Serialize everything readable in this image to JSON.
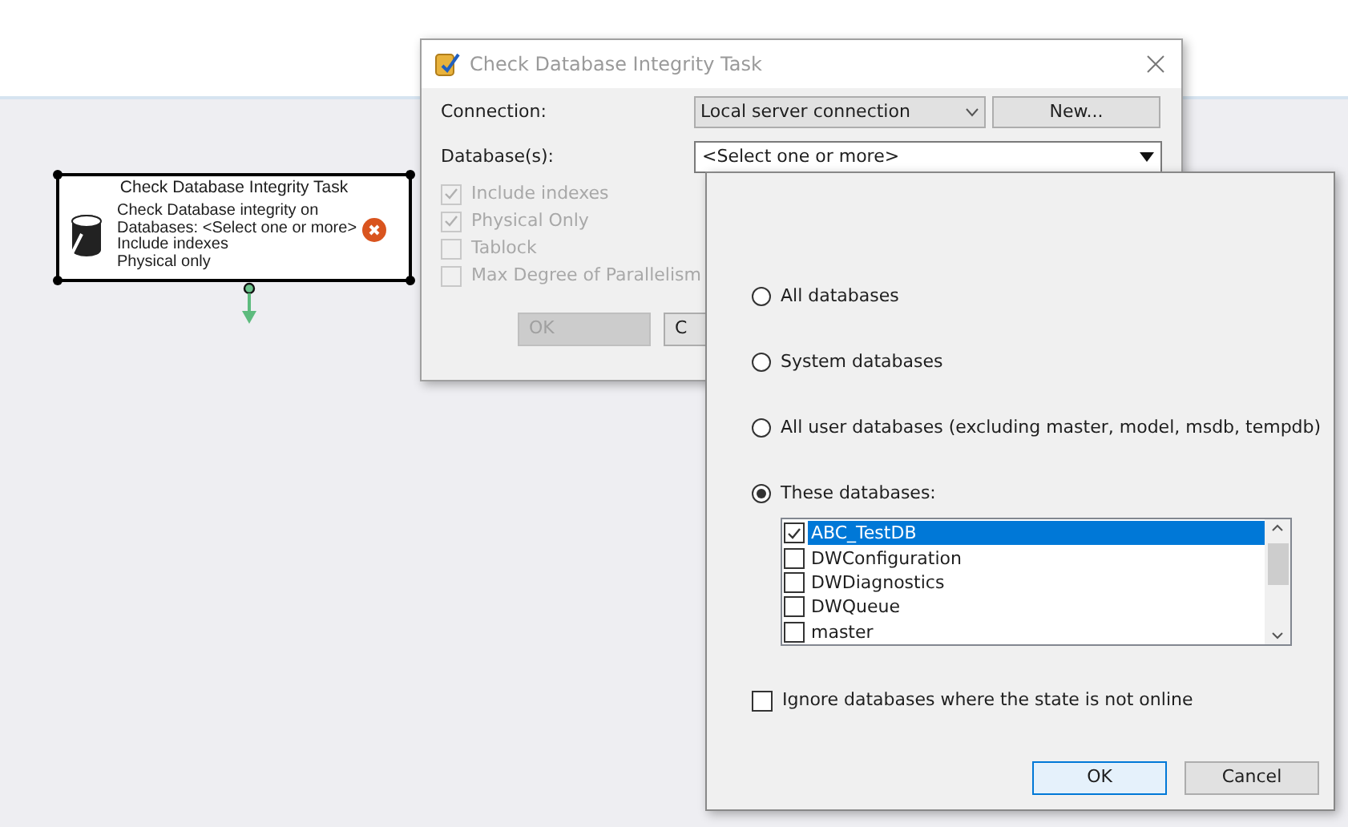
{
  "task": {
    "title": "Check Database Integrity Task",
    "lines": [
      "Check Database integrity on",
      "Databases: <Select one or more>",
      "Include indexes",
      "Physical only"
    ],
    "has_error": true
  },
  "dialog": {
    "title": "Check Database Integrity Task",
    "connection": {
      "label": "Connection:",
      "value": "Local server connection",
      "button": "New..."
    },
    "databases": {
      "label": "Database(s):",
      "value": "<Select one or more>"
    },
    "options": [
      {
        "label": "Include indexes",
        "checked": true,
        "disabled": true
      },
      {
        "label": "Physical Only",
        "checked": true,
        "disabled": true
      },
      {
        "label": "Tablock",
        "checked": false,
        "disabled": true
      },
      {
        "label": "Max Degree of Parallelism",
        "checked": false,
        "disabled": true
      }
    ],
    "buttons": [
      {
        "label": "OK",
        "disabled": true
      },
      {
        "label": "C",
        "disabled": false
      }
    ]
  },
  "popup": {
    "choices": [
      {
        "label": "All databases",
        "selected": false
      },
      {
        "label": "System databases",
        "selected": false
      },
      {
        "label": "All user databases  (excluding master, model, msdb, tempdb)",
        "selected": false
      },
      {
        "label": "These databases:",
        "selected": true
      }
    ],
    "databases": [
      {
        "label": "ABC_TestDB",
        "checked": true,
        "selected": true
      },
      {
        "label": "DWConfiguration",
        "checked": false,
        "selected": false
      },
      {
        "label": "DWDiagnostics",
        "checked": false,
        "selected": false
      },
      {
        "label": "DWQueue",
        "checked": false,
        "selected": false
      },
      {
        "label": "master",
        "checked": false,
        "selected": false
      }
    ],
    "ignore_offline": {
      "label": "Ignore databases where the state is not online",
      "checked": false
    },
    "buttons": [
      {
        "label": "OK",
        "default": true
      },
      {
        "label": "Cancel",
        "default": false
      }
    ]
  }
}
